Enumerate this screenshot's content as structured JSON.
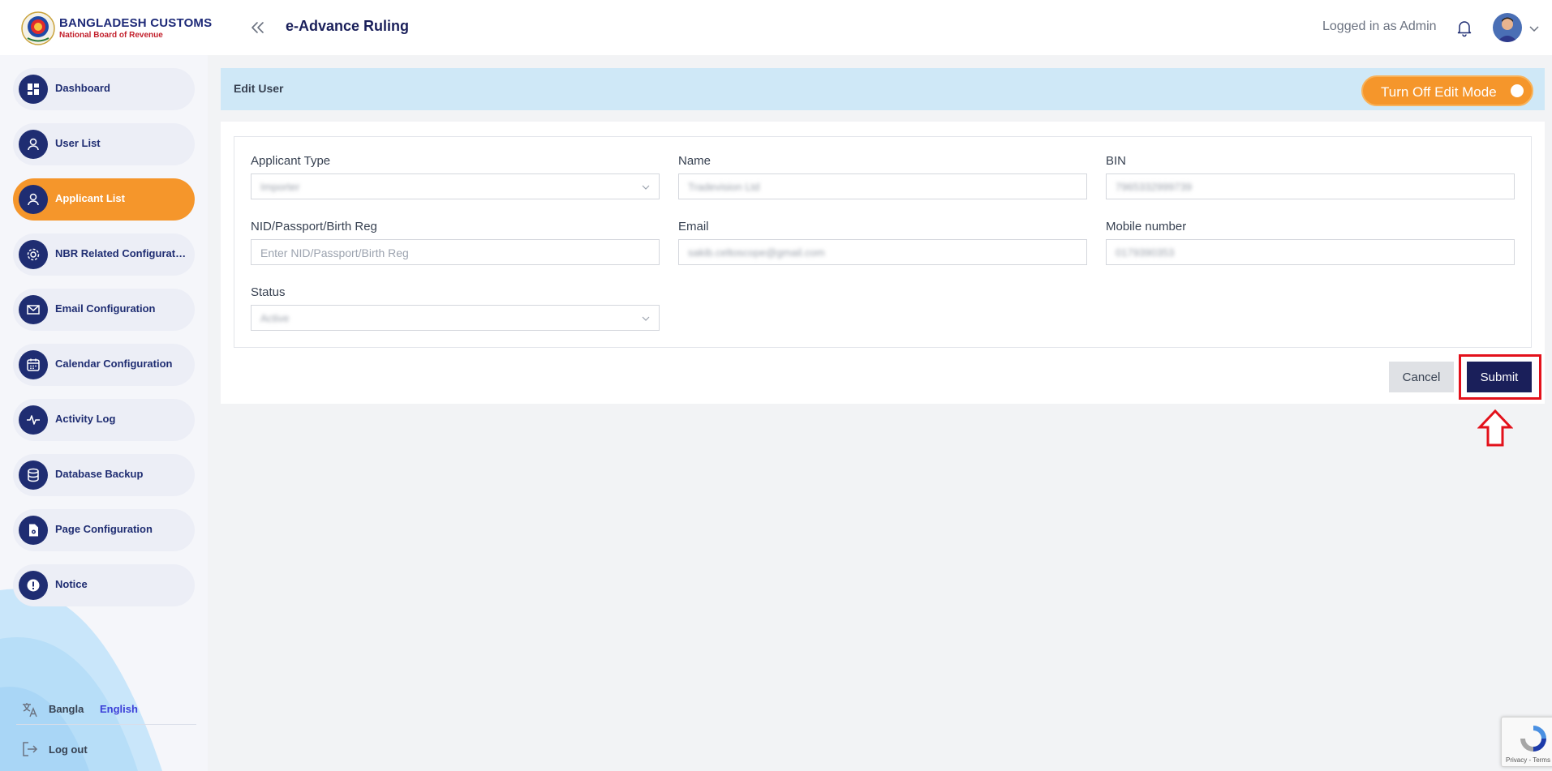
{
  "header": {
    "brand_title": "BANGLADESH CUSTOMS",
    "brand_subtitle": "National Board of Revenue",
    "app_title": "e-Advance Ruling",
    "logged_in_text": "Logged in as Admin"
  },
  "sidebar": {
    "items": [
      {
        "label": "Dashboard",
        "icon": "dashboard-icon",
        "active": false
      },
      {
        "label": "User List",
        "icon": "users-icon",
        "active": false
      },
      {
        "label": "Applicant List",
        "icon": "users-icon",
        "active": true
      },
      {
        "label": "NBR Related Configurations",
        "icon": "gear-icon",
        "active": false
      },
      {
        "label": "Email Configuration",
        "icon": "mail-icon",
        "active": false
      },
      {
        "label": "Calendar Configuration",
        "icon": "calendar-icon",
        "active": false
      },
      {
        "label": "Activity Log",
        "icon": "activity-icon",
        "active": false
      },
      {
        "label": "Database Backup",
        "icon": "database-icon",
        "active": false
      },
      {
        "label": "Page Configuration",
        "icon": "file-gear-icon",
        "active": false
      },
      {
        "label": "Notice",
        "icon": "alert-icon",
        "active": false
      }
    ],
    "language": {
      "bangla": "Bangla",
      "english": "English",
      "selected": "English"
    },
    "logout_label": "Log out"
  },
  "edit_bar": {
    "title": "Edit User",
    "toggle_label": "Turn Off Edit Mode",
    "toggle_on": true
  },
  "form": {
    "applicant_type": {
      "label": "Applicant Type",
      "value": "Importer"
    },
    "name": {
      "label": "Name",
      "value": "Tradevision Ltd"
    },
    "bin": {
      "label": "BIN",
      "value": "7965332999739"
    },
    "nid": {
      "label": "NID/Passport/Birth Reg",
      "placeholder": "Enter NID/Passport/Birth Reg",
      "value": ""
    },
    "email": {
      "label": "Email",
      "value": "sakib.celtoscope@gmail.com"
    },
    "mobile": {
      "label": "Mobile number",
      "value": "0179390353"
    },
    "status": {
      "label": "Status",
      "value": "Active"
    }
  },
  "actions": {
    "cancel_label": "Cancel",
    "submit_label": "Submit"
  },
  "recaptcha": {
    "text": "Privacy - Terms"
  },
  "colors": {
    "primary": "#1a1f5a",
    "accent_orange": "#f5962b",
    "edit_bar_bg": "#cfe8f7",
    "highlight_red": "#e3111b"
  }
}
